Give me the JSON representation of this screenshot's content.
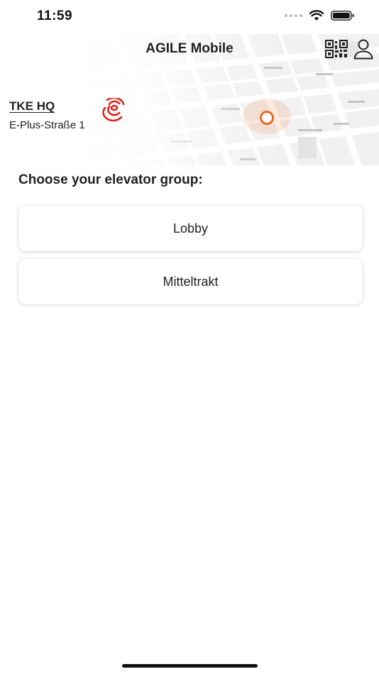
{
  "status_bar": {
    "time": "11:59"
  },
  "header": {
    "title": "AGILE Mobile",
    "site": {
      "name": "TKE HQ",
      "address": "E-Plus-Straße 1"
    }
  },
  "main": {
    "prompt": "Choose your elevator group:",
    "groups": [
      {
        "label": "Lobby"
      },
      {
        "label": "Mitteltrakt"
      }
    ]
  },
  "icons": {
    "qr": "qr-code-icon",
    "profile": "person-icon",
    "signal": "broadcast-signal-icon",
    "marker": "location-marker-icon",
    "wifi": "wifi-icon",
    "battery": "battery-icon"
  },
  "colors": {
    "accent": "#e2231a",
    "marker": "#ea6a1f",
    "text": "#222222"
  }
}
